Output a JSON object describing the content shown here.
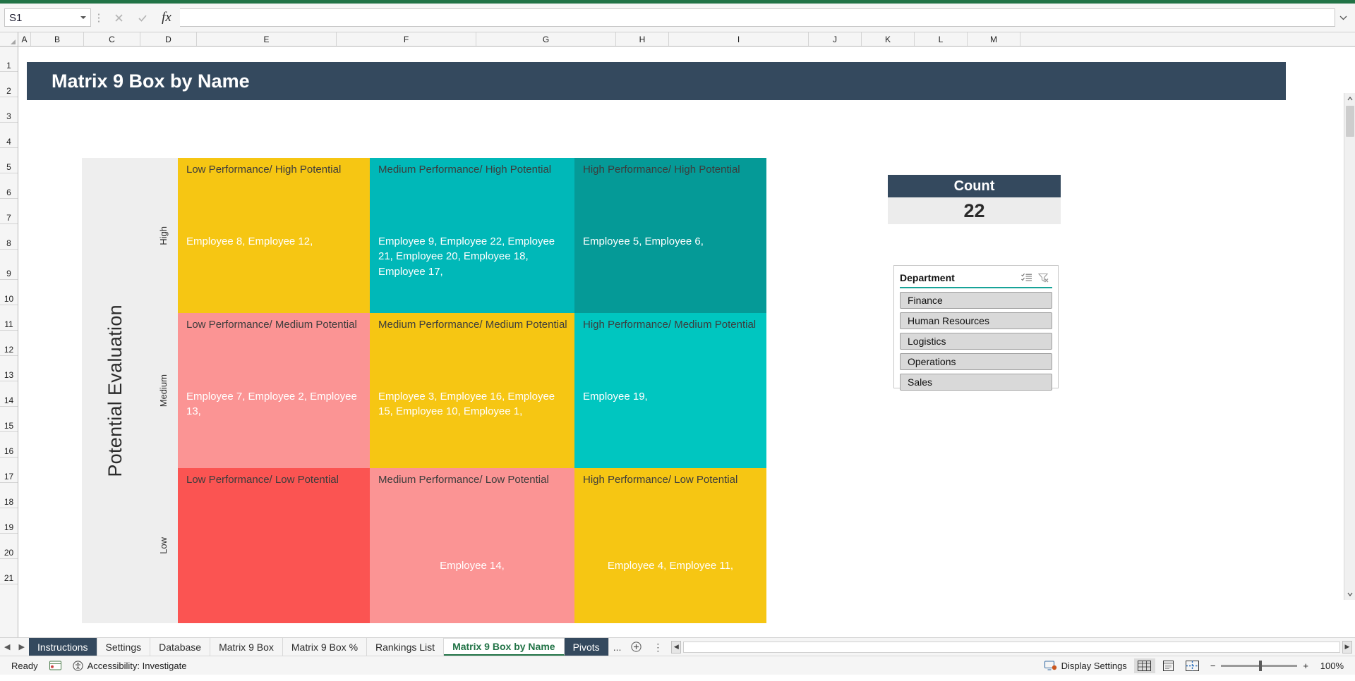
{
  "formula_bar": {
    "name_box_value": "S1",
    "formula_value": "",
    "cancel_icon": "close-icon",
    "confirm_icon": "check-icon",
    "function_icon": "fx"
  },
  "columns": [
    "A",
    "B",
    "C",
    "D",
    "E",
    "F",
    "G",
    "H",
    "I",
    "J",
    "K",
    "L",
    "M"
  ],
  "rows": [
    "1",
    "2",
    "3",
    "4",
    "5",
    "6",
    "7",
    "8",
    "9",
    "10",
    "11",
    "12",
    "13",
    "14",
    "15",
    "16",
    "17",
    "18",
    "19",
    "20",
    "21"
  ],
  "sheet": {
    "title": "Matrix 9 Box by Name"
  },
  "matrix": {
    "axis_title": "Potential Evaluation",
    "axis_ticks": [
      "High",
      "Medium",
      "Low"
    ],
    "cells": [
      {
        "title": "Low Performance/ High Potential",
        "names": "Employee 8, Employee 12,",
        "bg": "#f6c613",
        "title_color": "#3c3c3c"
      },
      {
        "title": "Medium Performance/ High Potential",
        "names": "Employee 9, Employee 22, Employee 21, Employee 20, Employee 18, Employee 17,",
        "bg": "#00b8b8",
        "title_color": "#3c3c3c"
      },
      {
        "title": "High Performance/ High Potential",
        "names": "Employee 5, Employee 6,",
        "bg": "#059a97",
        "title_color": "#3c3c3c"
      },
      {
        "title": "Low Performance/ Medium Potential",
        "names": "Employee 7, Employee 2, Employee 13,",
        "bg": "#fb9494",
        "title_color": "#3c3c3c"
      },
      {
        "title": "Medium Performance/ Medium Potential",
        "names": "Employee 3, Employee 16, Employee 15, Employee 10, Employee 1,",
        "bg": "#f6c613",
        "title_color": "#3c3c3c"
      },
      {
        "title": "High Performance/ Medium Potential",
        "names": "Employee 19,",
        "bg": "#00c6c0",
        "title_color": "#3c3c3c"
      },
      {
        "title": "Low Performance/ Low Potential",
        "names": "",
        "bg": "#fb5452",
        "title_color": "#3c3c3c"
      },
      {
        "title": "Medium Performance/ Low Potential",
        "names": "Employee 14,",
        "bg": "#fb9494",
        "title_color": "#3c3c3c"
      },
      {
        "title": "High Performance/ Low Potential",
        "names": "Employee 4, Employee 11,",
        "bg": "#f6c613",
        "title_color": "#3c3c3c"
      }
    ]
  },
  "count_card": {
    "header": "Count",
    "value": "22"
  },
  "slicer": {
    "title": "Department",
    "multiselect_icon": "multi-select-icon",
    "clear_filter_icon": "clear-filter-icon",
    "items": [
      "Finance",
      "Human Resources",
      "Logistics",
      "Operations",
      "Sales"
    ]
  },
  "tabs": {
    "prev_icon": "nav-prev-icon",
    "next_icon": "nav-next-icon",
    "items": [
      {
        "label": "Instructions",
        "state": "selected-dark"
      },
      {
        "label": "Settings",
        "state": "normal"
      },
      {
        "label": "Database",
        "state": "normal"
      },
      {
        "label": "Matrix 9 Box",
        "state": "normal"
      },
      {
        "label": "Matrix 9 Box %",
        "state": "normal"
      },
      {
        "label": "Rankings List",
        "state": "normal"
      },
      {
        "label": "Matrix 9 Box by Name",
        "state": "active"
      },
      {
        "label": "Pivots",
        "state": "selected-dark"
      }
    ],
    "overflow": "...",
    "add_label": "+",
    "more_label": "⋮"
  },
  "status_bar": {
    "ready": "Ready",
    "macro_icon": "record-macro-icon",
    "accessibility_icon": "accessibility-icon",
    "accessibility": "Accessibility: Investigate",
    "display_settings": "Display Settings",
    "display_settings_icon": "display-settings-icon",
    "view_normal_icon": "normal-view-icon",
    "view_pagelayout_icon": "page-layout-view-icon",
    "view_pagebreak_icon": "page-break-view-icon",
    "zoom_out": "−",
    "zoom_in": "+",
    "zoom_level": "100%"
  },
  "colors": {
    "excel_green": "#217346",
    "banner_navy": "#34495e",
    "teal_accent": "#17a398"
  }
}
